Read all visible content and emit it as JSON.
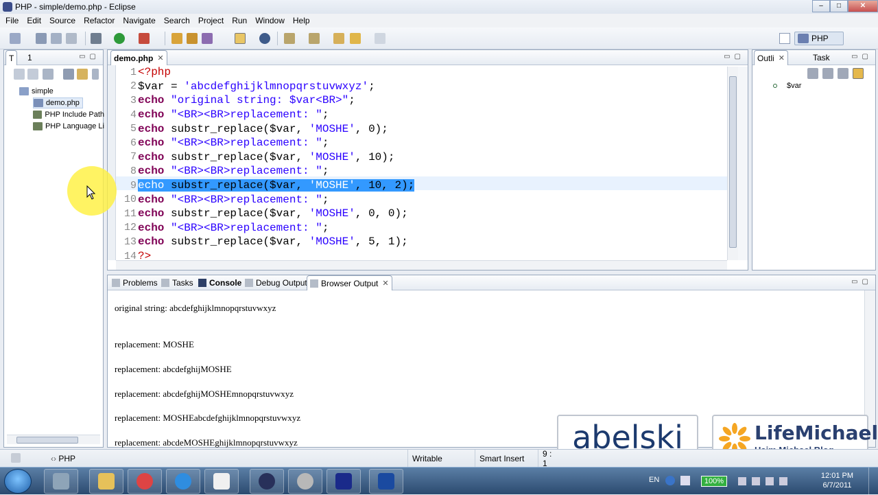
{
  "window": {
    "title": "PHP - simple/demo.php - Eclipse"
  },
  "menu": [
    "File",
    "Edit",
    "Source",
    "Refactor",
    "Navigate",
    "Search",
    "Project",
    "Run",
    "Window",
    "Help"
  ],
  "perspective": {
    "label": "PHP"
  },
  "left_panel": {
    "tabs": [
      "T",
      "1"
    ],
    "tree": [
      {
        "label": "simple",
        "level": 0
      },
      {
        "label": "demo.php",
        "level": 1
      },
      {
        "label": "PHP Include Path",
        "level": 1
      },
      {
        "label": "PHP Language Li",
        "level": 1
      }
    ]
  },
  "editor": {
    "tab": "demo.php",
    "lines": [
      {
        "n": "1",
        "tokens": [
          {
            "t": "<?php",
            "c": "tg"
          }
        ]
      },
      {
        "n": "2",
        "tokens": [
          {
            "t": "$var = ",
            "c": "v"
          },
          {
            "t": "'abcdefghijklmnopqrstuvwxyz'",
            "c": "s"
          },
          {
            "t": ";",
            "c": "pu"
          }
        ]
      },
      {
        "n": "3",
        "tokens": [
          {
            "t": "echo",
            "c": "k"
          },
          {
            "t": " ",
            "c": "v"
          },
          {
            "t": "\"original string: $var<BR>\"",
            "c": "s"
          },
          {
            "t": ";",
            "c": "pu"
          }
        ]
      },
      {
        "n": "4",
        "tokens": [
          {
            "t": "echo",
            "c": "k"
          },
          {
            "t": " ",
            "c": "v"
          },
          {
            "t": "\"<BR><BR>replacement: \"",
            "c": "s"
          },
          {
            "t": ";",
            "c": "pu"
          }
        ]
      },
      {
        "n": "5",
        "tokens": [
          {
            "t": "echo",
            "c": "k"
          },
          {
            "t": " substr_replace($var, ",
            "c": "v"
          },
          {
            "t": "'MOSHE'",
            "c": "s"
          },
          {
            "t": ", 0);",
            "c": "v"
          }
        ]
      },
      {
        "n": "6",
        "tokens": [
          {
            "t": "echo",
            "c": "k"
          },
          {
            "t": " ",
            "c": "v"
          },
          {
            "t": "\"<BR><BR>replacement: \"",
            "c": "s"
          },
          {
            "t": ";",
            "c": "pu"
          }
        ]
      },
      {
        "n": "7",
        "tokens": [
          {
            "t": "echo",
            "c": "k"
          },
          {
            "t": " substr_replace($var, ",
            "c": "v"
          },
          {
            "t": "'MOSHE'",
            "c": "s"
          },
          {
            "t": ", 10);",
            "c": "v"
          }
        ]
      },
      {
        "n": "8",
        "tokens": [
          {
            "t": "echo",
            "c": "k"
          },
          {
            "t": " ",
            "c": "v"
          },
          {
            "t": "\"<BR><BR>replacement: \"",
            "c": "s"
          },
          {
            "t": ";",
            "c": "pu"
          }
        ]
      },
      {
        "n": "9",
        "selected": true,
        "tokens": [
          {
            "t": "echo",
            "c": "k"
          },
          {
            "t": " substr_replace($var, ",
            "c": "v"
          },
          {
            "t": "'MOSHE'",
            "c": "s"
          },
          {
            "t": ", 10, 2);",
            "c": "v"
          }
        ]
      },
      {
        "n": "10",
        "tokens": [
          {
            "t": "echo",
            "c": "k"
          },
          {
            "t": " ",
            "c": "v"
          },
          {
            "t": "\"<BR><BR>replacement: \"",
            "c": "s"
          },
          {
            "t": ";",
            "c": "pu"
          }
        ]
      },
      {
        "n": "11",
        "tokens": [
          {
            "t": "echo",
            "c": "k"
          },
          {
            "t": " substr_replace($var, ",
            "c": "v"
          },
          {
            "t": "'MOSHE'",
            "c": "s"
          },
          {
            "t": ", 0, 0);",
            "c": "v"
          }
        ]
      },
      {
        "n": "12",
        "tokens": [
          {
            "t": "echo",
            "c": "k"
          },
          {
            "t": " ",
            "c": "v"
          },
          {
            "t": "\"<BR><BR>replacement: \"",
            "c": "s"
          },
          {
            "t": ";",
            "c": "pu"
          }
        ]
      },
      {
        "n": "13",
        "tokens": [
          {
            "t": "echo",
            "c": "k"
          },
          {
            "t": " substr_replace($var, ",
            "c": "v"
          },
          {
            "t": "'MOSHE'",
            "c": "s"
          },
          {
            "t": ", 5, 1);",
            "c": "v"
          }
        ]
      },
      {
        "n": "14",
        "tokens": [
          {
            "t": "?>",
            "c": "tg"
          }
        ]
      }
    ]
  },
  "outline": {
    "tabs": [
      "Outli",
      "Task"
    ],
    "items": [
      "$var"
    ]
  },
  "bottom": {
    "tabs": [
      "Problems",
      "Tasks",
      "Console",
      "Debug Output",
      "Browser Output"
    ],
    "output": [
      "original string: abcdefghijklmnopqrstuvwxyz",
      "replacement: MOSHE",
      "replacement: abcdefghijMOSHE",
      "replacement: abcdefghijMOSHEmnopqrstuvwxyz",
      "replacement: MOSHEabcdefghijklmnopqrstuvwxyz",
      "replacement: abcdeMOSHEghijklmnopqrstuvwxyz"
    ]
  },
  "status": {
    "left": "PHP",
    "writable": "Writable",
    "mode": "Smart Insert",
    "pos": "9 : 1"
  },
  "branding": {
    "logo1": "abelski",
    "logo2_title": "LifeMichael",
    "logo2_sub": "Haim Michael Blog"
  },
  "taskbar": {
    "lang": "EN",
    "battery": "100%",
    "time": "12:01 PM",
    "date": "6/7/2011"
  },
  "colors": {
    "keyword": "#7f0055",
    "string": "#2a00ff",
    "selection": "#3399ff"
  }
}
